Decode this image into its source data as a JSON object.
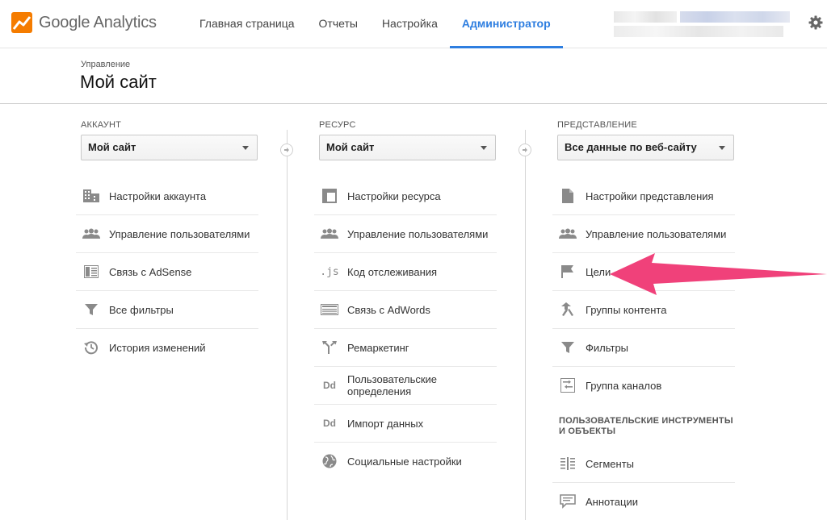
{
  "topbar": {
    "logo_google": "Google",
    "logo_analytics": "Analytics",
    "nav": [
      {
        "label": "Главная страница"
      },
      {
        "label": "Отчеты"
      },
      {
        "label": "Настройка"
      },
      {
        "label": "Администратор",
        "active": true
      }
    ]
  },
  "header": {
    "breadcrumb": "Управление",
    "title": "Мой сайт"
  },
  "account": {
    "label": "АККАУНТ",
    "selected": "Мой сайт",
    "items": [
      {
        "label": "Настройки аккаунта",
        "icon": "building-icon"
      },
      {
        "label": "Управление пользователями",
        "icon": "users-icon"
      },
      {
        "label": "Связь с AdSense",
        "icon": "adsense-icon"
      },
      {
        "label": "Все фильтры",
        "icon": "filter-icon"
      },
      {
        "label": "История изменений",
        "icon": "history-icon"
      }
    ]
  },
  "property": {
    "label": "РЕСУРС",
    "selected": "Мой сайт",
    "items": [
      {
        "label": "Настройки ресурса",
        "icon": "window-icon"
      },
      {
        "label": "Управление пользователями",
        "icon": "users-icon"
      },
      {
        "label": "Код отслеживания",
        "icon": "js-icon"
      },
      {
        "label": "Связь с AdWords",
        "icon": "adwords-icon"
      },
      {
        "label": "Ремаркетинг",
        "icon": "remarketing-icon"
      },
      {
        "label_1": "Пользовательские",
        "label_2": "определения",
        "icon": "dd-icon"
      },
      {
        "label": "Импорт данных",
        "icon": "dd-icon"
      },
      {
        "label": "Социальные настройки",
        "icon": "globe-icon"
      }
    ]
  },
  "view": {
    "label": "ПРЕДСТАВЛЕНИЕ",
    "selected": "Все данные по веб-сайту",
    "items": [
      {
        "label": "Настройки представления",
        "icon": "document-icon"
      },
      {
        "label": "Управление пользователями",
        "icon": "users-icon"
      },
      {
        "label": "Цели",
        "icon": "flag-icon"
      },
      {
        "label": "Группы контента",
        "icon": "content-groups-icon"
      },
      {
        "label": "Фильтры",
        "icon": "filter-icon"
      },
      {
        "label": "Группа каналов",
        "icon": "channels-icon"
      }
    ],
    "section_title_1": "ПОЛЬЗОВАТЕЛЬСКИЕ ИНСТРУМЕНТЫ",
    "section_title_2": "И ОБЪЕКТЫ",
    "tools": [
      {
        "label": "Сегменты",
        "icon": "segments-icon"
      },
      {
        "label": "Аннотации",
        "icon": "annotations-icon"
      }
    ]
  },
  "colors": {
    "accent": "#2e7ee0",
    "logo_orange": "#f57c00",
    "callout_arrow": "#f0417a"
  }
}
